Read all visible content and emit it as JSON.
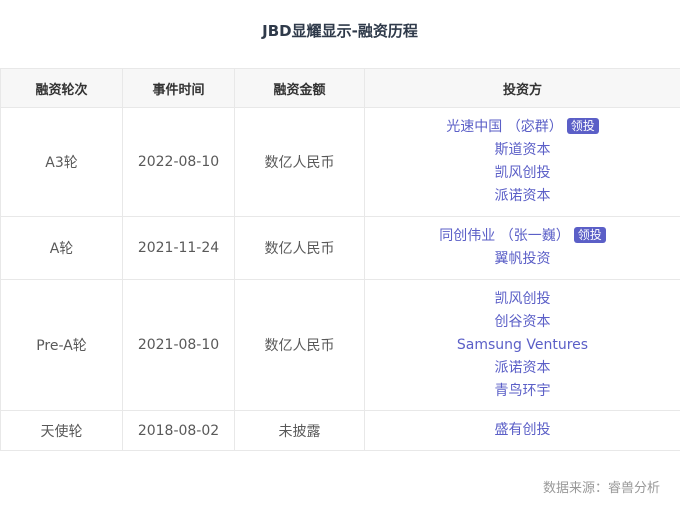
{
  "title": "JBD显耀显示-融资历程",
  "columns": [
    "融资轮次",
    "事件时间",
    "融资金额",
    "投资方"
  ],
  "lead_label": "领投",
  "rounds": [
    {
      "round": "A3轮",
      "date": "2022-08-10",
      "amount": "数亿人民币",
      "investors": [
        {
          "name": "光速中国 （宓群）",
          "lead": true
        },
        {
          "name": "斯道资本",
          "lead": false
        },
        {
          "name": "凯风创投",
          "lead": false
        },
        {
          "name": "派诺资本",
          "lead": false
        }
      ]
    },
    {
      "round": "A轮",
      "date": "2021-11-24",
      "amount": "数亿人民币",
      "investors": [
        {
          "name": "同创伟业 （张一巍）",
          "lead": true
        },
        {
          "name": "翼帆投资",
          "lead": false
        }
      ]
    },
    {
      "round": "Pre-A轮",
      "date": "2021-08-10",
      "amount": "数亿人民币",
      "investors": [
        {
          "name": "凯风创投",
          "lead": false
        },
        {
          "name": "创谷资本",
          "lead": false
        },
        {
          "name": "Samsung Ventures",
          "lead": false
        },
        {
          "name": "派诺资本",
          "lead": false
        },
        {
          "name": "青鸟环宇",
          "lead": false
        }
      ]
    },
    {
      "round": "天使轮",
      "date": "2018-08-02",
      "amount": "未披露",
      "investors": [
        {
          "name": "盛有创投",
          "lead": false
        }
      ]
    }
  ],
  "source": "数据来源：睿兽分析",
  "colors": {
    "investor_link": "#5b5fc7",
    "badge_bg": "#5b5fc7",
    "header_bg": "#f7f7f7"
  }
}
